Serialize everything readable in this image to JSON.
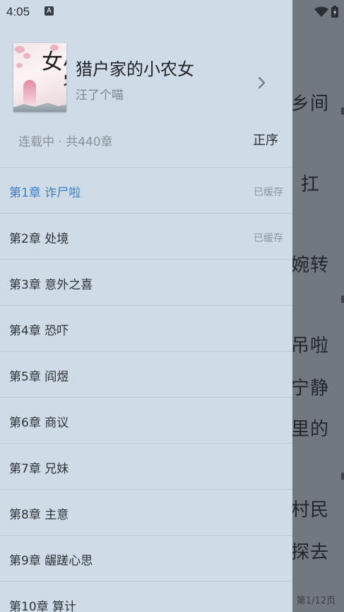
{
  "status_bar": {
    "time": "4:05",
    "notification_glyph": "A",
    "carrier_text": "",
    "icons": [
      "wifi-icon",
      "battery-icon"
    ]
  },
  "reader": {
    "text_fragments": [
      "乡间",
      "扛",
      "婉转",
      "吊啦",
      "宁静",
      "里的",
      "村民",
      "探去"
    ],
    "page_indicator": "第1/12页"
  },
  "drawer": {
    "book": {
      "title": "猎户家的小农女",
      "author": "汪了个喵",
      "cover_text": "小农女"
    },
    "status_text": "连载中 · 共440章",
    "sort_label": "正序",
    "chapters": [
      {
        "title": "第1章 诈尸啦",
        "cache": "已缓存",
        "current": true
      },
      {
        "title": "第2章 处境",
        "cache": "已缓存",
        "current": false
      },
      {
        "title": "第3章 意外之喜",
        "cache": "",
        "current": false
      },
      {
        "title": "第4章 恐吓",
        "cache": "",
        "current": false
      },
      {
        "title": "第5章 阎煜",
        "cache": "",
        "current": false
      },
      {
        "title": "第6章 商议",
        "cache": "",
        "current": false
      },
      {
        "title": "第7章 兄妹",
        "cache": "",
        "current": false
      },
      {
        "title": "第8章 主意",
        "cache": "",
        "current": false
      },
      {
        "title": "第9章 龌蹉心思",
        "cache": "",
        "current": false
      },
      {
        "title": "第10章 算计",
        "cache": "",
        "current": false
      }
    ]
  },
  "colors": {
    "drawer_bg": "#cfdbe7",
    "current_chapter": "#3b7fc4",
    "scrim": "#727880"
  }
}
